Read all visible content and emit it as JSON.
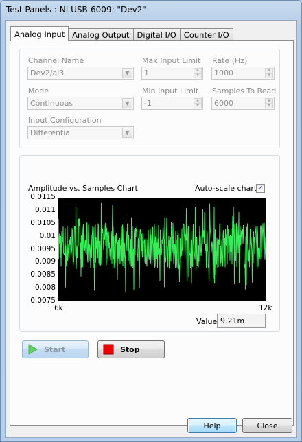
{
  "window": {
    "title": "Test Panels : NI USB-6009: \"Dev2\""
  },
  "tabs": [
    {
      "label": "Analog Input",
      "active": true
    },
    {
      "label": "Analog Output",
      "active": false
    },
    {
      "label": "Digital I/O",
      "active": false
    },
    {
      "label": "Counter I/O",
      "active": false
    }
  ],
  "config": {
    "channel_name": {
      "label": "Channel Name",
      "value": "Dev2/ai3"
    },
    "max_input_limit": {
      "label": "Max Input Limit",
      "value": "1"
    },
    "rate": {
      "label": "Rate (Hz)",
      "value": "1000"
    },
    "mode": {
      "label": "Mode",
      "value": "Continuous"
    },
    "min_input_limit": {
      "label": "Min Input Limit",
      "value": "-1"
    },
    "samples_to_read": {
      "label": "Samples To Read",
      "value": "6000"
    },
    "input_configuration": {
      "label": "Input Configuration",
      "value": "Differential"
    }
  },
  "chart": {
    "title": "Amplitude vs. Samples Chart",
    "autoscale_label": "Auto-scale chart",
    "autoscale_checked": true,
    "value_label": "Value",
    "value": "9.21m"
  },
  "chart_data": {
    "type": "line",
    "title": "Amplitude vs. Samples Chart",
    "xlabel": "",
    "ylabel": "",
    "xlim": [
      6000,
      12000
    ],
    "ylim": [
      0.0075,
      0.0115
    ],
    "x_ticks": [
      "6k",
      "12k"
    ],
    "y_ticks": [
      "0.0115",
      "0.011",
      "0.0105",
      "0.01",
      "0.0095",
      "0.009",
      "0.0085",
      "0.008",
      "0.0075"
    ],
    "grid": false,
    "series": [
      {
        "color": "#33ee55",
        "band_core": [
          0.00875,
          0.01055
        ],
        "band_extremes": [
          0.0078,
          0.0113
        ],
        "description_mean": 0.0096
      }
    ],
    "background": "#000000"
  },
  "buttons": {
    "start": "Start",
    "stop": "Stop",
    "help": "Help",
    "close": "Close"
  },
  "colors": {
    "trace": "#33ee55",
    "stop_icon": "#ee0000",
    "start_icon": "#5ed35e"
  }
}
